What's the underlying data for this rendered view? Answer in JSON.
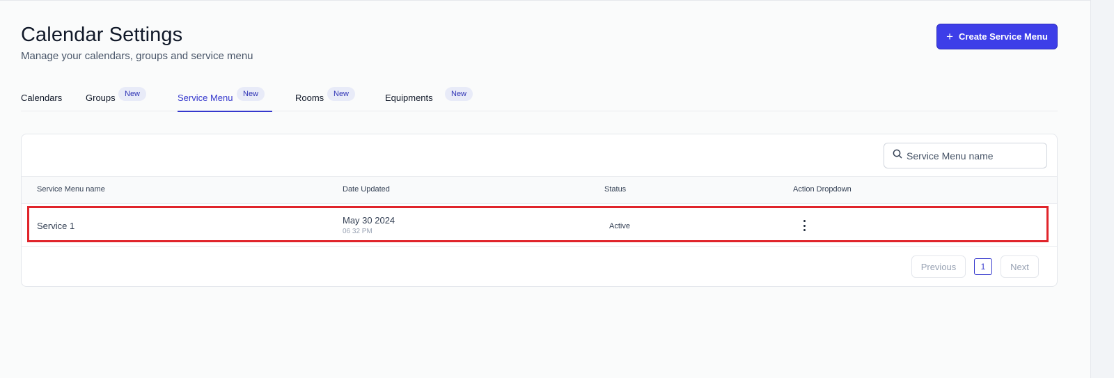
{
  "header": {
    "title": "Calendar Settings",
    "subtitle": "Manage your calendars, groups and service menu",
    "create_button_label": "Create Service Menu"
  },
  "tabs": [
    {
      "label": "Calendars",
      "badge": ""
    },
    {
      "label": "Groups",
      "badge": "New"
    },
    {
      "label": "Service Menu",
      "badge": "New",
      "active": true
    },
    {
      "label": "Rooms",
      "badge": "New"
    },
    {
      "label": "Equipments",
      "badge": "New"
    }
  ],
  "search": {
    "placeholder": "Service Menu name",
    "value": ""
  },
  "table": {
    "columns": [
      "Service Menu name",
      "Date Updated",
      "Status",
      "Action Dropdown"
    ],
    "rows": [
      {
        "name": "Service 1",
        "date": "May 30 2024",
        "time": "06 32 PM",
        "status": "Active"
      }
    ]
  },
  "pagination": {
    "previous_label": "Previous",
    "current_page": "1",
    "next_label": "Next"
  },
  "colors": {
    "accent": "#3d3ee8",
    "highlight": "#e0242b"
  },
  "icons": {
    "create": "plus-icon",
    "search": "search-icon",
    "actions": "kebab-menu-icon"
  }
}
